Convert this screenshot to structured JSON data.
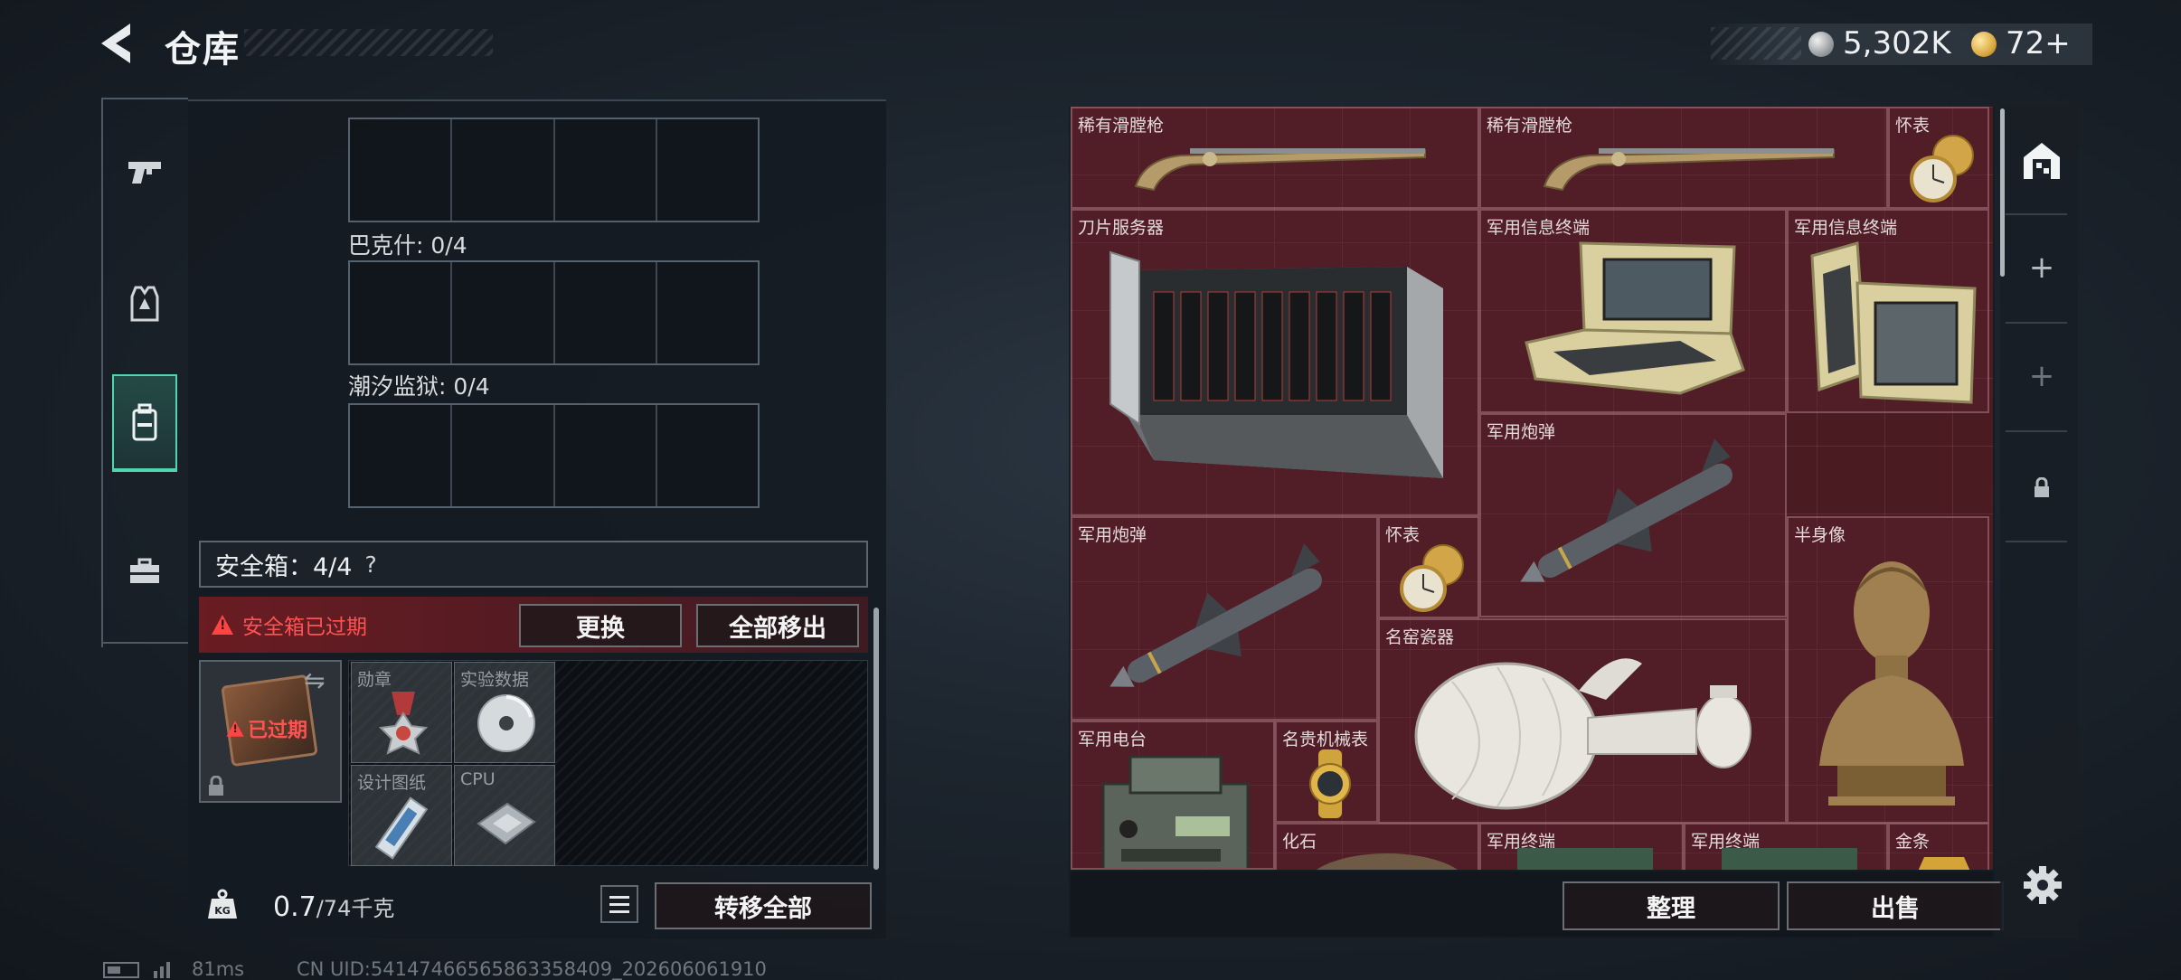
{
  "header": {
    "title": "仓库",
    "currencies": [
      {
        "icon": "silver-coin-icon",
        "amount": "5,302K"
      },
      {
        "icon": "gold-coin-icon",
        "amount": "72+"
      }
    ]
  },
  "categories": [
    {
      "icon": "pistol-icon",
      "active": false
    },
    {
      "icon": "armor-vest-icon",
      "active": false
    },
    {
      "icon": "backpack-icon",
      "active": true
    },
    {
      "icon": "toolbox-icon",
      "active": false
    }
  ],
  "storage": {
    "slot_groups": [
      {
        "label": "巴克什: 0/4"
      },
      {
        "label": "潮汐监狱: 0/4"
      }
    ],
    "safebox": {
      "label": "安全箱：4/4",
      "help": "?",
      "warning": "安全箱已过期",
      "item_status": "已过期",
      "replace_label": "更换",
      "move_all_label": "全部移出",
      "items": [
        {
          "name": "勋章",
          "icon": "medal-icon"
        },
        {
          "name": "实验数据",
          "icon": "disc-icon"
        },
        {
          "name": "设计图纸",
          "icon": "blueprint-icon"
        },
        {
          "name": "CPU",
          "icon": "cpu-icon"
        }
      ]
    },
    "weight": {
      "current": "0.7",
      "capacity": "/74千克"
    },
    "transfer_all_label": "转移全部"
  },
  "inventory": {
    "items": [
      {
        "name": "稀有滑膛枪",
        "icon": "musket-icon"
      },
      {
        "name": "稀有滑膛枪",
        "icon": "musket-icon"
      },
      {
        "name": "怀表",
        "icon": "pocket-watch-icon"
      },
      {
        "name": "刀片服务器",
        "icon": "blade-server-icon"
      },
      {
        "name": "军用信息终端",
        "icon": "military-terminal-icon"
      },
      {
        "name": "军用信息终端",
        "icon": "military-terminal-icon"
      },
      {
        "name": "军用炮弹",
        "icon": "missile-icon"
      },
      {
        "name": "军用炮弹",
        "icon": "missile-icon"
      },
      {
        "name": "怀表",
        "icon": "pocket-watch-icon"
      },
      {
        "name": "半身像",
        "icon": "bust-icon"
      },
      {
        "name": "名窑瓷器",
        "icon": "porcelain-vase-icon"
      },
      {
        "name": "军用电台",
        "icon": "military-radio-icon"
      },
      {
        "name": "名贵机械表",
        "icon": "luxury-watch-icon"
      },
      {
        "name": "化石",
        "icon": "fossil-icon"
      },
      {
        "name": "军用终端",
        "icon": "terminal-icon"
      },
      {
        "name": "军用终端",
        "icon": "terminal-icon"
      },
      {
        "name": "金条",
        "icon": "gold-bar-icon"
      }
    ],
    "sort_label": "整理",
    "sell_label": "出售"
  },
  "side_tools": [
    {
      "icon": "home-storage-icon"
    },
    {
      "icon": "plus-icon"
    },
    {
      "icon": "plus-icon"
    },
    {
      "icon": "lock-icon"
    }
  ],
  "status_bar": {
    "ping": "81ms",
    "uid": "CN UID:54147466565863358409_202606061910"
  }
}
